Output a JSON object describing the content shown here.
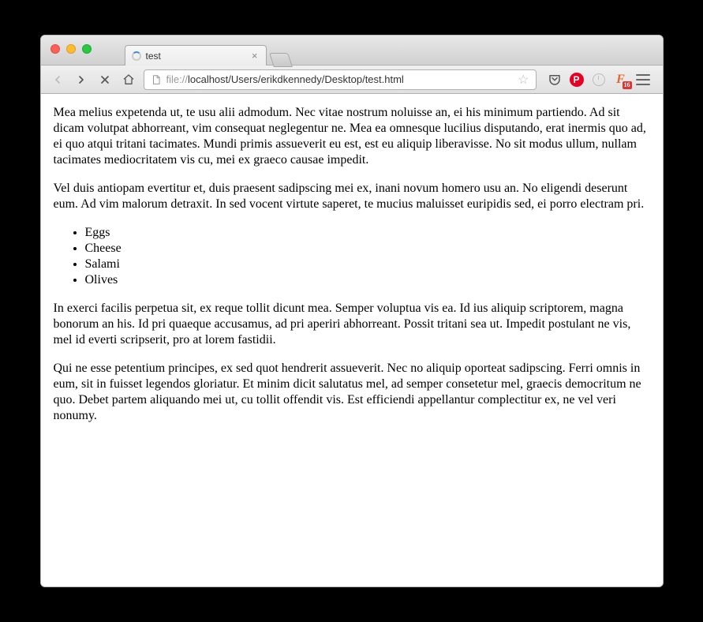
{
  "tab": {
    "title": "test"
  },
  "address": {
    "scheme": "file://",
    "path": "localhost/Users/erikdkennedy/Desktop/test.html"
  },
  "extensions": {
    "pinterest_letter": "P",
    "firebug_letter": "F",
    "firebug_badge": "16"
  },
  "content": {
    "p1": "Mea melius expetenda ut, te usu alii admodum. Nec vitae nostrum noluisse an, ei his minimum partiendo. Ad sit dicam volutpat abhorreant, vim consequat neglegentur ne. Mea ea omnesque lucilius disputando, erat inermis quo ad, ei quo atqui tritani tacimates. Mundi primis assueverit eu est, est eu aliquip liberavisse. No sit modus ullum, nullam tacimates mediocritatem vis cu, mei ex graeco causae impedit.",
    "p2": "Vel duis antiopam evertitur et, duis praesent sadipscing mei ex, inani novum homero usu an. No eligendi deserunt eum. Ad vim malorum detraxit. In sed vocent virtute saperet, te mucius maluisset euripidis sed, ei porro electram pri.",
    "list": {
      "i0": "Eggs",
      "i1": "Cheese",
      "i2": "Salami",
      "i3": "Olives"
    },
    "p3": "In exerci facilis perpetua sit, ex reque tollit dicunt mea. Semper voluptua vis ea. Id ius aliquip scriptorem, magna bonorum an his. Id pri quaeque accusamus, ad pri aperiri abhorreant. Possit tritani sea ut. Impedit postulant ne vis, mel id everti scripserit, pro at lorem fastidii.",
    "p4": "Qui ne esse petentium principes, ex sed quot hendrerit assueverit. Nec no aliquip oporteat sadipscing. Ferri omnis in eum, sit in fuisset legendos gloriatur. Et minim dicit salutatus mel, ad semper consetetur mel, graecis democritum ne quo. Debet partem aliquando mei ut, cu tollit offendit vis. Est efficiendi appellantur complectitur ex, ne vel veri nonumy."
  }
}
